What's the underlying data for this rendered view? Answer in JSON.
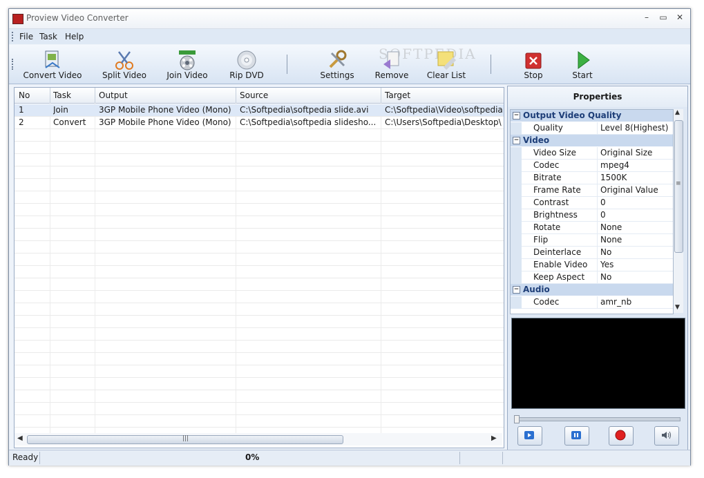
{
  "window": {
    "title": "Proview Video Converter"
  },
  "menu": [
    "File",
    "Task",
    "Help"
  ],
  "toolbar": {
    "convert_video": "Convert Video",
    "split_video": "Split Video",
    "join_video": "Join Video",
    "rip_dvd": "Rip DVD",
    "settings": "Settings",
    "remove": "Remove",
    "clear_list": "Clear List",
    "stop": "Stop",
    "start": "Start",
    "watermark": "SOFTPEDIA"
  },
  "tasks": {
    "columns": [
      "No",
      "Task",
      "Output",
      "Source",
      "Target"
    ],
    "rows": [
      [
        "1",
        "Join",
        "3GP Mobile Phone Video (Mono)",
        "C:\\Softpedia\\softpedia slide.avi",
        "C:\\Softpedia\\Video\\softpedia"
      ],
      [
        "2",
        "Convert",
        "3GP Mobile Phone Video (Mono)",
        "C:\\Softpedia\\softpedia slidesho...",
        "C:\\Users\\Softpedia\\Desktop\\"
      ]
    ]
  },
  "properties": {
    "title": "Properties",
    "sections": {
      "output_quality": "Output Video Quality",
      "video": "Video",
      "audio": "Audio"
    },
    "quality": {
      "key": "Quality",
      "value": "Level 8(Highest)"
    },
    "video_rows": [
      {
        "key": "Video Size",
        "value": "Original Size"
      },
      {
        "key": "Codec",
        "value": "mpeg4"
      },
      {
        "key": "Bitrate",
        "value": "1500K"
      },
      {
        "key": "Frame Rate",
        "value": "Original Value"
      },
      {
        "key": "Contrast",
        "value": "0"
      },
      {
        "key": "Brightness",
        "value": "0"
      },
      {
        "key": "Rotate",
        "value": "None"
      },
      {
        "key": "Flip",
        "value": "None"
      },
      {
        "key": "Deinterlace",
        "value": "No"
      },
      {
        "key": "Enable Video",
        "value": "Yes"
      },
      {
        "key": "Keep Aspect",
        "value": "No"
      }
    ],
    "audio_codec": {
      "key": "Codec",
      "value": "amr_nb"
    }
  },
  "status": {
    "text": "Ready",
    "progress": "0%"
  },
  "colors": {
    "accent": "#1e3e78",
    "stop_red": "#d03030",
    "start_green": "#3cb043",
    "player_blue": "#2a6fd0"
  }
}
